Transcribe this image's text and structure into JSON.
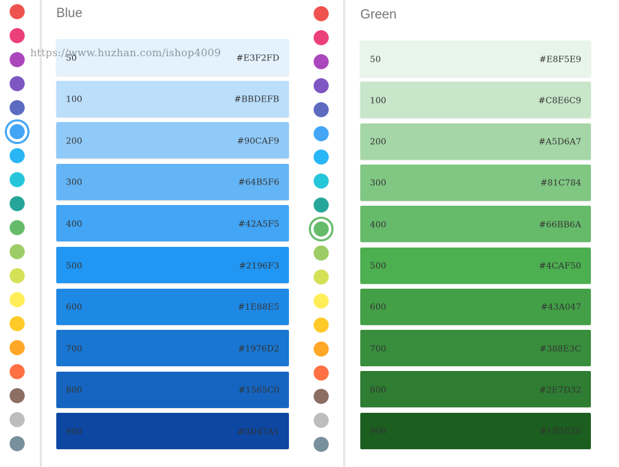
{
  "palette_dots": [
    "#EF5350",
    "#EC407A",
    "#AB47BC",
    "#7E57C2",
    "#5C6BC0",
    "#42A5F5",
    "#29B6F6",
    "#26C6DA",
    "#26A69A",
    "#66BB6A",
    "#9CCC65",
    "#D4E157",
    "#FFEE58",
    "#FFCA28",
    "#FFA726",
    "#FF7043",
    "#8D6E63",
    "#BDBDBD",
    "#78909C"
  ],
  "left_selected": 5,
  "right_selected": 9,
  "blue": {
    "title": "Blue",
    "swatches": [
      {
        "shade": "50",
        "hex": "#E3F2FD",
        "text": "#333333"
      },
      {
        "shade": "100",
        "hex": "#BBDEFB",
        "text": "#333333"
      },
      {
        "shade": "200",
        "hex": "#90CAF9",
        "text": "#333333"
      },
      {
        "shade": "300",
        "hex": "#64B5F6",
        "text": "#333333"
      },
      {
        "shade": "400",
        "hex": "#42A5F5",
        "text": "#333333"
      },
      {
        "shade": "500",
        "hex": "#2196F3",
        "text": "#333333"
      },
      {
        "shade": "600",
        "hex": "#1E88E5",
        "text": "#333333"
      },
      {
        "shade": "700",
        "hex": "#1976D2",
        "text": "#333333"
      },
      {
        "shade": "800",
        "hex": "#1565C0",
        "text": "#333333"
      },
      {
        "shade": "900",
        "hex": "#0D47A1",
        "text": "#333333"
      }
    ]
  },
  "green": {
    "title": "Green",
    "swatches": [
      {
        "shade": "50",
        "hex": "#E8F5E9",
        "text": "#333333"
      },
      {
        "shade": "100",
        "hex": "#C8E6C9",
        "text": "#333333"
      },
      {
        "shade": "200",
        "hex": "#A5D6A7",
        "text": "#333333"
      },
      {
        "shade": "300",
        "hex": "#81C784",
        "text": "#333333"
      },
      {
        "shade": "400",
        "hex": "#66BB6A",
        "text": "#333333"
      },
      {
        "shade": "500",
        "hex": "#4CAF50",
        "text": "#333333"
      },
      {
        "shade": "600",
        "hex": "#43A047",
        "text": "#333333"
      },
      {
        "shade": "700",
        "hex": "#388E3C",
        "text": "#333333"
      },
      {
        "shade": "800",
        "hex": "#2E7D32",
        "text": "#333333"
      },
      {
        "shade": "900",
        "hex": "#1B5E20",
        "text": "#333333"
      }
    ]
  },
  "watermark": "https://www.huzhan.com/ishop4009"
}
